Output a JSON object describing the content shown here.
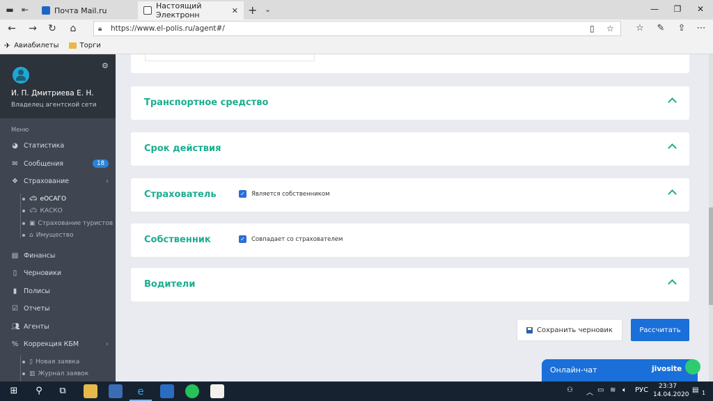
{
  "browser": {
    "tabs": [
      {
        "label": "Почта Mail.ru",
        "active": false
      },
      {
        "label": "Настоящий Электронн",
        "active": true
      }
    ],
    "url": "https://www.el-polis.ru/agent#/",
    "favorites": [
      {
        "label": "Авиабилеты",
        "icon": "plane-icon"
      },
      {
        "label": "Торги",
        "icon": "folder-icon"
      }
    ]
  },
  "sidebar": {
    "user_name": "И. П. Дмитриева Е. Н.",
    "user_role": "Владелец агентской сети",
    "menu_title": "Меню",
    "items": [
      {
        "label": "Статистика",
        "icon": "pie-chart-icon"
      },
      {
        "label": "Сообщения",
        "icon": "envelope-icon",
        "badge": "18"
      },
      {
        "label": "Страхование",
        "icon": "cubes-icon"
      },
      {
        "label": "Финансы",
        "icon": "money-icon"
      },
      {
        "label": "Черновики",
        "icon": "file-icon"
      },
      {
        "label": "Полисы",
        "icon": "document-icon"
      },
      {
        "label": "Отчеты",
        "icon": "clipboard-icon"
      },
      {
        "label": "Агенты",
        "icon": "users-icon"
      },
      {
        "label": "Коррекция КБМ",
        "icon": "percent-icon"
      }
    ],
    "insurance_sub": [
      {
        "label": "еОСАГО",
        "active": true
      },
      {
        "label": "КАСКО",
        "active": false
      },
      {
        "label": "Страхование туристов",
        "active": false
      },
      {
        "label": "Имущество",
        "active": false
      }
    ],
    "kbm_sub": [
      {
        "label": "Новая заявка"
      },
      {
        "label": "Журнал заявок"
      }
    ]
  },
  "sections": [
    {
      "title": "Транспортное средство",
      "checkbox": null
    },
    {
      "title": "Срок действия",
      "checkbox": null
    },
    {
      "title": "Страхователь",
      "checkbox": "Является собственником"
    },
    {
      "title": "Собственник",
      "checkbox": "Совпадает со страхователем"
    },
    {
      "title": "Водители",
      "checkbox": null
    }
  ],
  "actions": {
    "save_draft": "Сохранить черновик",
    "calculate": "Рассчитать"
  },
  "chat": {
    "label": "Онлайн-чат",
    "brand": "jivosite"
  },
  "taskbar": {
    "language": "РУС",
    "time": "23:37",
    "date": "14.04.2020",
    "notifications": "1"
  },
  "colors": {
    "accent_green": "#1aae8f",
    "primary_blue": "#1a6fd9",
    "sidebar_bg": "#3f4651"
  }
}
